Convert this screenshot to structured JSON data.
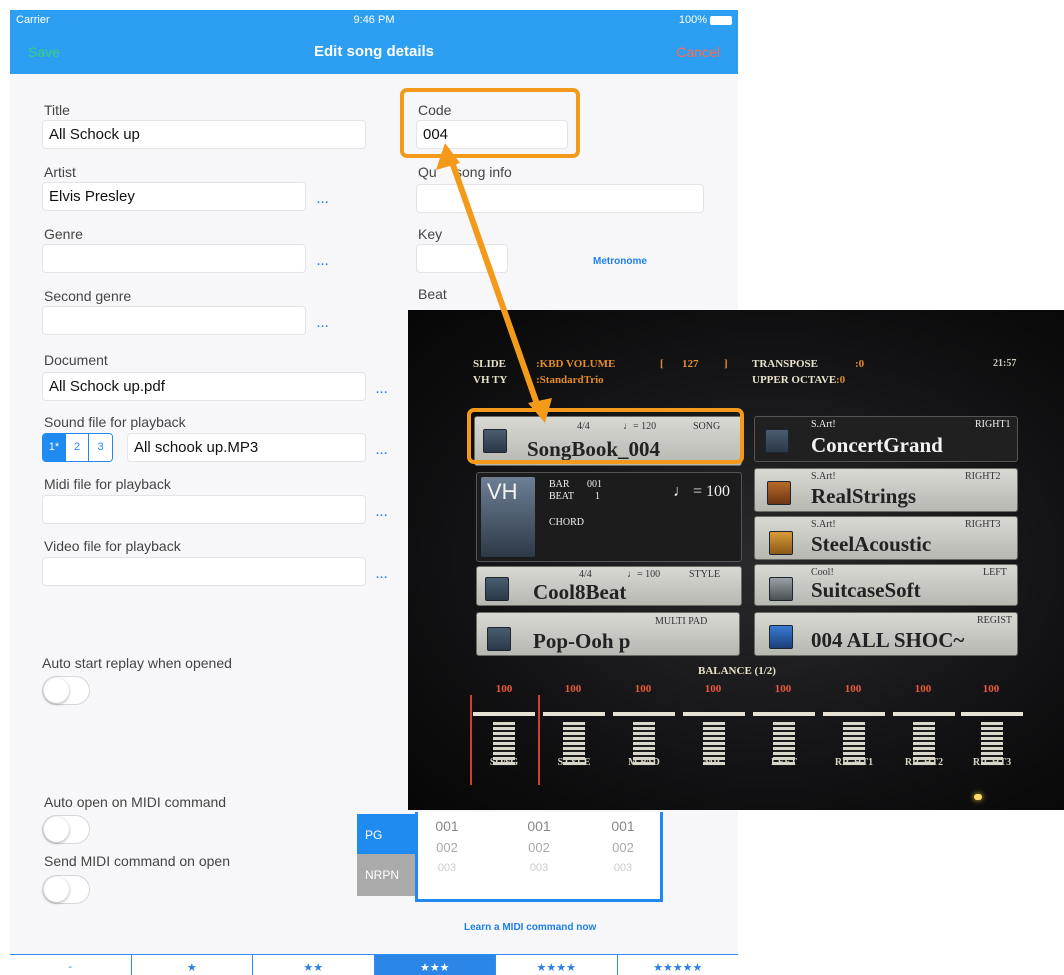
{
  "status_bar": {
    "carrier": "Carrier",
    "time": "9:46 PM",
    "battery": "100%"
  },
  "nav": {
    "title": "Edit song details",
    "save": "Save",
    "cancel": "Cancel"
  },
  "form": {
    "title_label": "Title",
    "title_value": "All Schock up",
    "artist_label": "Artist",
    "artist_value": "Elvis Presley",
    "genre_label": "Genre",
    "genre_value": "",
    "second_genre_label": "Second genre",
    "second_genre_value": "",
    "document_label": "Document",
    "document_value": "All Schock up.pdf",
    "sound_label": "Sound file for playback",
    "sound_value": "All schook up.MP3",
    "sound_tabs": [
      "1*",
      "2",
      "3"
    ],
    "midi_label": "Midi file for playback",
    "midi_value": "",
    "video_label": "Video file for playback",
    "video_value": "",
    "code_label": "Code",
    "code_value": "004",
    "quick_info_label_left": "Qu",
    "quick_info_label_right": "song info",
    "quick_info_value": "",
    "key_label": "Key",
    "key_value": "",
    "metronome": "Metronome",
    "beat_label": "Beat",
    "more": "..."
  },
  "toggles": {
    "auto_start": "Auto start replay when opened",
    "auto_open": "Auto open on MIDI command",
    "send_midi": "Send MIDI command on open"
  },
  "midi": {
    "pg": "PG",
    "nrpn": "NRPN",
    "columns": [
      [
        "001",
        "002",
        "003"
      ],
      [
        "001",
        "002",
        "003"
      ],
      [
        "001",
        "002",
        "003"
      ]
    ],
    "learn": "Learn a MIDI command now"
  },
  "rating": [
    "-",
    "★",
    "★★",
    "★★★",
    "★★★★",
    "★★★★★"
  ],
  "keyboard": {
    "slider_label": "SLIDE",
    "slider_value": ":KBD VOLUME",
    "slider_num": "127",
    "bracket_l": "[",
    "bracket_r": "]",
    "vh_label": "VH TY",
    "vh_value": ":StandardTrio",
    "transpose_label": "TRANSPOSE",
    "transpose_value": ":0",
    "octave_label": "UPPER OCTAVE",
    "octave_value": ":0",
    "clock": "21:57",
    "song": {
      "meter": "4/4",
      "tempo": "♩= 120",
      "tag": "SONG",
      "name": "SongBook_004"
    },
    "bar_label": "BAR",
    "bar_value": "001",
    "beat_label": "BEAT",
    "beat_value": "1",
    "chord": "CHORD",
    "tempo_big": "♩ = 100",
    "vh_logo": "VH",
    "style": {
      "meter": "4/4",
      "tempo": "♩= 100",
      "tag": "STYLE",
      "name": "Cool8Beat"
    },
    "multipad": {
      "tag": "MULTI PAD",
      "name": "Pop-Ooh p"
    },
    "right1": {
      "prefix": "S.Art!",
      "tag": "RIGHT1",
      "name": "ConcertGrand"
    },
    "right2": {
      "prefix": "S.Art!",
      "tag": "RIGHT2",
      "name": "RealStrings"
    },
    "right3": {
      "prefix": "S.Art!",
      "tag": "RIGHT3",
      "name": "SteelAcoustic"
    },
    "left": {
      "prefix": "Cool!",
      "tag": "LEFT",
      "name": "SuitcaseSoft"
    },
    "regist": {
      "tag": "REGIST",
      "name": "004 ALL SHOC~"
    },
    "balance_title": "BALANCE (1/2)",
    "balance": [
      {
        "value": "100",
        "name": "SONG"
      },
      {
        "value": "100",
        "name": "STYLE"
      },
      {
        "value": "100",
        "name": "M.PAD"
      },
      {
        "value": "100",
        "name": "MIC"
      },
      {
        "value": "100",
        "name": "LEFT"
      },
      {
        "value": "100",
        "name": "RIGHT1"
      },
      {
        "value": "100",
        "name": "RIGHT2"
      },
      {
        "value": "100",
        "name": "RIGHT3"
      }
    ]
  },
  "colors": {
    "accent": "#2d9ff3",
    "save": "#36d17a",
    "cancel": "#ff6a4d",
    "highlight": "#f49a1b"
  }
}
